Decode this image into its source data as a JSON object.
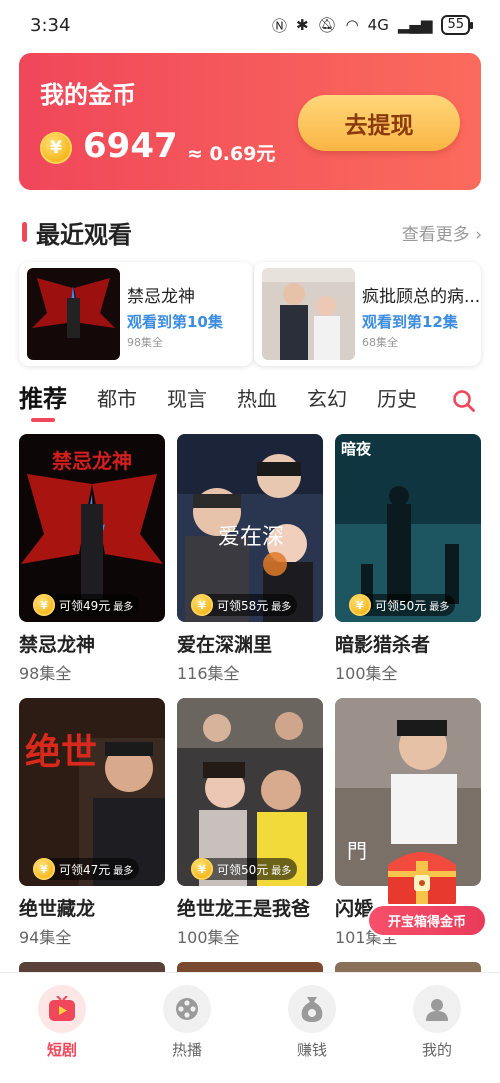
{
  "status_bar": {
    "time": "3:34",
    "network": "4G",
    "battery": "55"
  },
  "coins": {
    "title": "我的金币",
    "coin_symbol": "¥",
    "amount": "6947",
    "approx": "≈ 0.69元",
    "withdraw_label": "去提现"
  },
  "recent": {
    "title": "最近观看",
    "see_more": "查看更多 ›",
    "items": [
      {
        "name": "禁忌龙神",
        "progress": "观看到第10集",
        "episodes": "98集全"
      },
      {
        "name": "疯批顾总的病...",
        "progress": "观看到第12集",
        "episodes": "68集全"
      }
    ]
  },
  "tabs": [
    "推荐",
    "都市",
    "现言",
    "热血",
    "玄幻",
    "历史"
  ],
  "dramas": [
    {
      "title": "禁忌龙神",
      "episodes": "98集全",
      "reward": "可领49元",
      "reward_tag": "最多"
    },
    {
      "title": "爱在深渊里",
      "episodes": "116集全",
      "reward": "可领58元",
      "reward_tag": "最多"
    },
    {
      "title": "暗影猎杀者",
      "episodes": "100集全",
      "reward": "可领50元",
      "reward_tag": "最多"
    },
    {
      "title": "绝世藏龙",
      "episodes": "94集全",
      "reward": "可领47元",
      "reward_tag": "最多"
    },
    {
      "title": "绝世龙王是我爸",
      "episodes": "100集全",
      "reward": "可领50元",
      "reward_tag": "最多"
    },
    {
      "title": "闪婚",
      "episodes": "101集全",
      "reward": "",
      "reward_tag": ""
    }
  ],
  "poster_text": {
    "p1": "禁忌龙神",
    "p2": "爱在深",
    "p3": "暗夜",
    "p4": "绝世",
    "p6": "門"
  },
  "treasure": {
    "label": "开宝箱得金币"
  },
  "nav": [
    {
      "label": "短剧",
      "active": true
    },
    {
      "label": "热播",
      "active": false
    },
    {
      "label": "赚钱",
      "active": false
    },
    {
      "label": "我的",
      "active": false
    }
  ],
  "colors": {
    "brand": "#f0475a",
    "progress_blue": "#3c8de0",
    "withdraw_gold": "#f9b544"
  }
}
